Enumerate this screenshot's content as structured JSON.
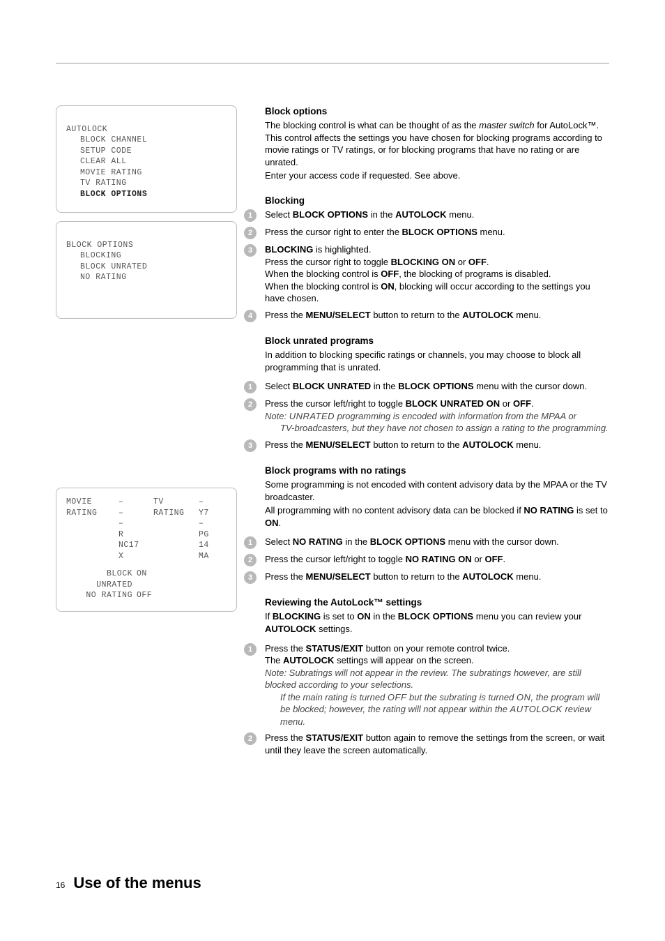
{
  "sidebar": {
    "box1": {
      "title": "AUTOLOCK",
      "items": [
        "BLOCK CHANNEL",
        "SETUP CODE",
        "CLEAR ALL",
        "MOVIE RATING",
        "TV RATING",
        "BLOCK OPTIONS"
      ],
      "boldIndex": 5
    },
    "box2": {
      "title": "BLOCK OPTIONS",
      "items": [
        "BLOCKING",
        "BLOCK UNRATED",
        "NO RATING"
      ]
    },
    "ratings": {
      "movie_label": "MOVIE RATING",
      "movie_values": [
        "–",
        "–",
        "–",
        "R",
        "NC17",
        "X"
      ],
      "tv_label": "TV RATING",
      "tv_values": [
        "–",
        "Y7",
        "–",
        "PG",
        "14",
        "MA"
      ],
      "bottom": [
        {
          "label": "BLOCK UNRATED",
          "value": "ON"
        },
        {
          "label": "NO RATING",
          "value": "OFF"
        }
      ]
    }
  },
  "content": {
    "s1": {
      "heading": "Block options",
      "p1a": "The blocking control is what can be thought of as the ",
      "p1b": "master switch",
      "p1c": " for AutoLock™. This control affects the settings you have chosen for blocking programs according to movie ratings or TV ratings, or for blocking programs that have no rating or are unrated.",
      "p2": "Enter your access code if requested. See above."
    },
    "s2": {
      "heading": "Blocking",
      "step1a": "Select ",
      "step1b": "BLOCK OPTIONS",
      "step1c": " in the ",
      "step1d": "AUTOLOCK",
      "step1e": " menu.",
      "step2a": "Press the cursor right to enter the ",
      "step2b": "BLOCK OPTIONS",
      "step2c": " menu.",
      "step3a": "BLOCKING",
      "step3b": " is highlighted.",
      "step3c": "Press the cursor right to toggle ",
      "step3d": "BLOCKING ON",
      "step3e": " or ",
      "step3f": "OFF",
      "step3g": ".",
      "step3h": "When the blocking control is ",
      "step3i": "OFF",
      "step3j": ", the blocking of programs is disabled.",
      "step3k": "When the blocking control is ",
      "step3l": "ON",
      "step3m": ", blocking will occur according to the settings you have chosen.",
      "step4a": "Press the ",
      "step4b": "MENU/SELECT",
      "step4c": " button to return to the ",
      "step4d": "AUTOLOCK",
      "step4e": " menu."
    },
    "s3": {
      "heading": "Block unrated programs",
      "p1": "In addition to blocking specific ratings or channels, you may choose to block all programming that is unrated.",
      "step1a": "Select ",
      "step1b": "BLOCK UNRATED",
      "step1c": " in the ",
      "step1d": "BLOCK OPTIONS",
      "step1e": " menu with the cursor down.",
      "step2a": "Press the cursor left/right to toggle ",
      "step2b": "BLOCK UNRATED ON",
      "step2c": " or ",
      "step2d": "OFF",
      "step2e": ".",
      "step2note1a": "Note: ",
      "step2note1b": "UNRATED",
      "step2note1c": " programming is encoded with information from the MPAA or",
      "step2note2": "TV-broadcasters, but they have not chosen to assign a rating to the programming.",
      "step3a": "Press the ",
      "step3b": "MENU/SELECT",
      "step3c": " button to return to the ",
      "step3d": "AUTOLOCK",
      "step3e": " menu."
    },
    "s4": {
      "heading": "Block programs with no ratings",
      "p1": "Some programming is not encoded with content advisory data by the MPAA or the TV broadcaster.",
      "p2a": "All programming with no content advisory data can be blocked if ",
      "p2b": "NO RATING",
      "p2c": " is set to ",
      "p2d": "ON",
      "p2e": ".",
      "step1a": "Select ",
      "step1b": "NO RATING",
      "step1c": " in the ",
      "step1d": "BLOCK OPTIONS",
      "step1e": " menu with the cursor down.",
      "step2a": "Press the cursor left/right to toggle ",
      "step2b": "NO RATING ON",
      "step2c": " or ",
      "step2d": "OFF",
      "step2e": ".",
      "step3a": "Press the ",
      "step3b": "MENU/SELECT",
      "step3c": " button to return to the ",
      "step3d": "AUTOLOCK",
      "step3e": " menu."
    },
    "s5": {
      "heading": "Reviewing the AutoLock™ settings",
      "p1a": "If ",
      "p1b": "BLOCKING",
      "p1c": " is set to ",
      "p1d": "ON",
      "p1e": " in the ",
      "p1f": "BLOCK OPTIONS",
      "p1g": " menu you can review your ",
      "p1h": "AUTOLOCK",
      "p1i": " settings.",
      "step1a": "Press the ",
      "step1b": "STATUS/EXIT",
      "step1c": " button on your remote control twice.",
      "step1d": "The ",
      "step1e": "AUTOLOCK",
      "step1f": " settings will appear on the screen.",
      "step1note1": "Note: Subratings will not appear in the review. The subratings however, are still blocked according to your selections.",
      "step1note2a": "If the main rating is turned ",
      "step1note2b": "OFF",
      "step1note2c": " but the subrating is turned ",
      "step1note2d": "ON",
      "step1note2e": ", the program will be blocked; however, the rating will not appear within the ",
      "step1note2f": "AUTOLOCK",
      "step1note2g": " review menu.",
      "step2a": "Press the ",
      "step2b": "STATUS/EXIT",
      "step2c": " button again to remove the settings from the screen, or wait until they leave the screen automatically."
    }
  },
  "footer": {
    "page": "16",
    "title": "Use of the menus"
  }
}
